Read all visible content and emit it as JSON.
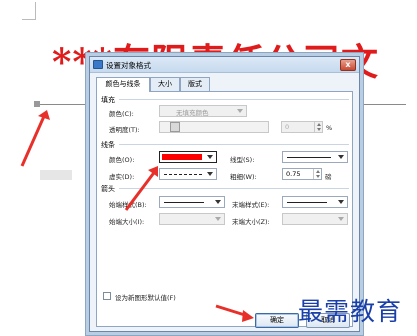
{
  "document": {
    "title": "***有限责任公司文",
    "watermark": "最需教育"
  },
  "dialog": {
    "title": "设置对象格式",
    "close_glyph": "x",
    "tabs": [
      "颜色与线条",
      "大小",
      "版式"
    ],
    "fill": {
      "section": "填充",
      "color_label": "颜色(C):",
      "color_value": "无填充颜色",
      "transparency_label": "透明度(T):",
      "transparency_value": "0",
      "transparency_unit": "%"
    },
    "line": {
      "section": "线条",
      "color_label": "颜色(O):",
      "color_value": "#ff0000",
      "style_label": "线型(S):",
      "dash_label": "虚实(D):",
      "weight_label": "粗细(W):",
      "weight_value": "0.75",
      "weight_unit": "磅"
    },
    "arrows": {
      "section": "箭头",
      "begin_style_label": "始端样式(B):",
      "end_style_label": "末端样式(E):",
      "begin_size_label": "始端大小(I):",
      "end_size_label": "末端大小(Z):"
    },
    "default_checkbox_label": "设为新图形默认值(F)",
    "ok_label": "确定",
    "cancel_label": "取消"
  },
  "colors": {
    "accent_red": "#ff0000",
    "title_red": "#e01b1b",
    "watermark_blue": "#1a3fa8"
  }
}
